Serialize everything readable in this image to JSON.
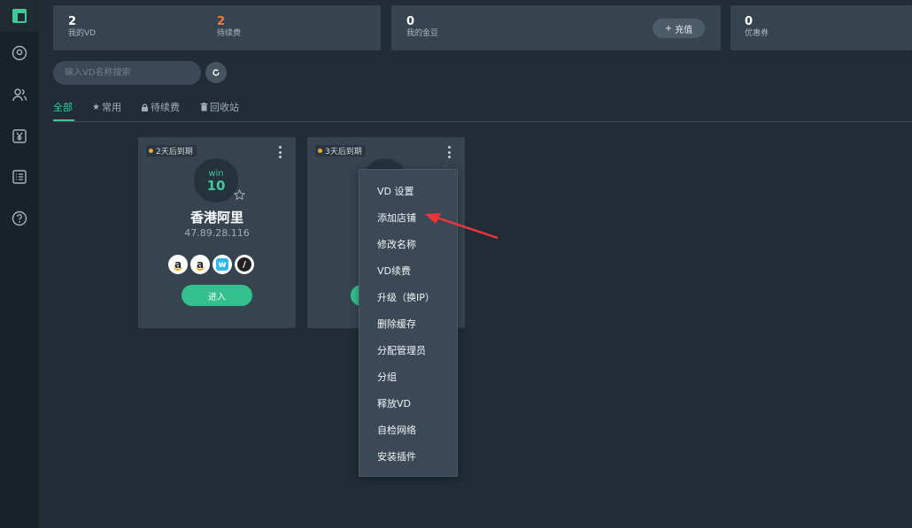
{
  "sidebar": {
    "items": [
      {
        "icon": "dashboard-icon",
        "active": true
      },
      {
        "icon": "user-circle-icon",
        "active": false
      },
      {
        "icon": "users-icon",
        "active": false
      },
      {
        "icon": "yen-icon",
        "active": false
      },
      {
        "icon": "list-icon",
        "active": false
      },
      {
        "icon": "help-icon",
        "active": false
      }
    ]
  },
  "stats": {
    "my_vd": {
      "value": "2",
      "label": "我的VD"
    },
    "pending_renewal": {
      "value": "2",
      "label": "待续费"
    },
    "my_beans": {
      "value": "0",
      "label": "我的金豆"
    },
    "recharge_label": "充值",
    "coupons": {
      "value": "0",
      "label": "优惠券"
    }
  },
  "search": {
    "placeholder": "输入VD名称搜索"
  },
  "tabs": [
    {
      "label": "全部",
      "icon": ""
    },
    {
      "label": "常用",
      "icon": "star-icon"
    },
    {
      "label": "待续费",
      "icon": "lock-icon"
    },
    {
      "label": "回收站",
      "icon": "trash-icon"
    }
  ],
  "cards": [
    {
      "expire": "2天后到期",
      "os_name": "win",
      "os_version": "10",
      "name": "香港阿里",
      "ip": "47.89.28.116",
      "platforms": [
        "amazon-icon",
        "amazon-icon",
        "wish-icon",
        "shopify-slash-icon"
      ],
      "platform_letters": [
        "a",
        "a",
        "w",
        "/"
      ],
      "enter_label": "进入"
    },
    {
      "expire": "3天后到期"
    }
  ],
  "menu": {
    "items": [
      "VD 设置",
      "添加店铺",
      "修改名称",
      "VD续费",
      "升级（换IP）",
      "删除缓存",
      "分配管理员",
      "分组",
      "释放VD",
      "自检网络",
      "安装插件"
    ]
  },
  "colors": {
    "accent": "#3ec89a",
    "orange": "#f07f3c",
    "annotation_arrow": "#e8353b"
  }
}
